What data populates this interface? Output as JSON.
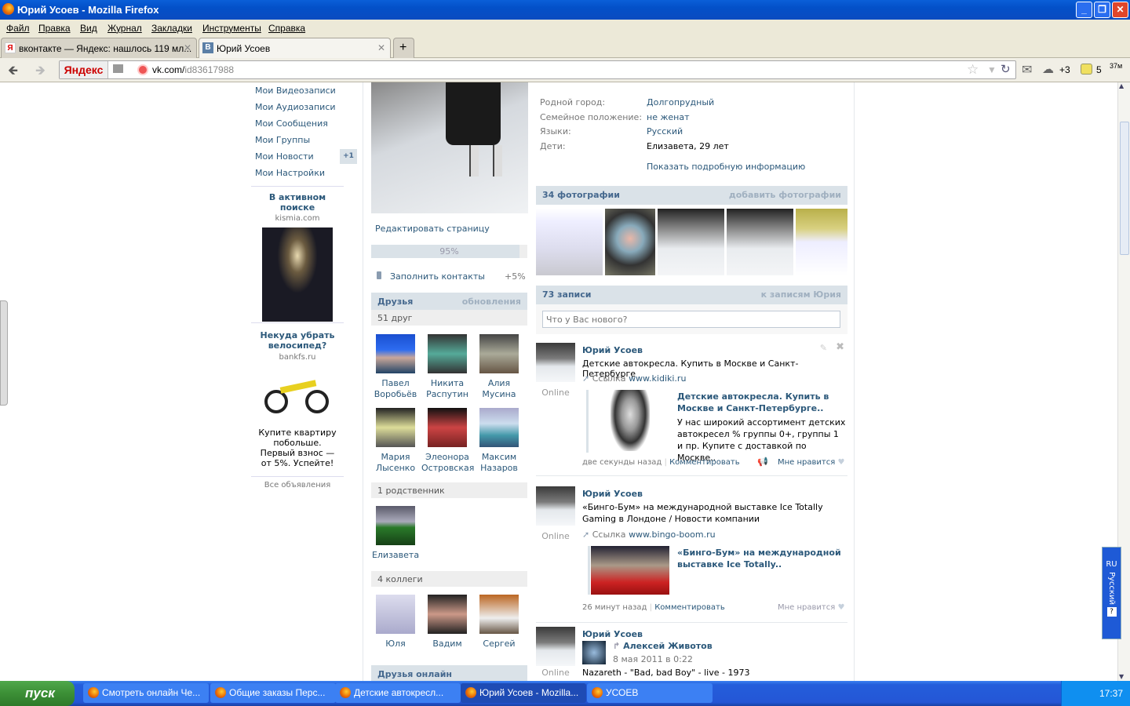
{
  "window": {
    "title": "Юрий Усоев - Mozilla Firefox"
  },
  "menu": [
    "Файл",
    "Правка",
    "Вид",
    "Журнал",
    "Закладки",
    "Инструменты",
    "Справка"
  ],
  "tabs": [
    {
      "label": "вконтакте — Яндекс: нашлось 119 мл...",
      "favicon": "Я"
    },
    {
      "label": "Юрий Усоев",
      "favicon": "В"
    }
  ],
  "nav": {
    "yandex": "Яндекс",
    "url_host": "vk.com/",
    "url_path": "id83617988",
    "cloud_count": "+3",
    "badge_count": "5",
    "mem": "37м"
  },
  "left_menu": [
    {
      "label": "Мои Видеозаписи"
    },
    {
      "label": "Мои Аудиозаписи"
    },
    {
      "label": "Мои Сообщения"
    },
    {
      "label": "Мои Группы"
    },
    {
      "label": "Мои Новости",
      "badge": "+1"
    },
    {
      "label": "Мои Настройки"
    }
  ],
  "ads": [
    {
      "title": "В активном поиске",
      "domain": "kismia.com"
    },
    {
      "title": "Некуда убрать велосипед?",
      "domain": "bankfs.ru",
      "text": "Купите квартиру побольше. Первый взнос — от 5%. Успейте!"
    }
  ],
  "all_ads": "Все объявления",
  "profile": {
    "edit": "Редактировать страницу",
    "progress_label": "95%",
    "progress": 95,
    "fill_contacts": "Заполнить контакты",
    "fill_bonus": "+5%"
  },
  "friends": {
    "title": "Друзья",
    "updates": "обновления",
    "count": "51 друг",
    "list": [
      [
        "Павел",
        "Воробьёв"
      ],
      [
        "Никита",
        "Распутин"
      ],
      [
        "Алия",
        "Мусина"
      ],
      [
        "Мария",
        "Лысенко"
      ],
      [
        "Элеонора",
        "Островская"
      ],
      [
        "Максим",
        "Назаров"
      ]
    ]
  },
  "relatives": {
    "count": "1 родственник",
    "list": [
      "Елизавета"
    ]
  },
  "colleagues": {
    "count": "4 коллеги",
    "list": [
      "Юля",
      "Вадим",
      "Сергей"
    ]
  },
  "friends_online": "Друзья онлайн",
  "info": [
    {
      "k": "Родной город:",
      "v": "Долгопрудный",
      "link": true
    },
    {
      "k": "Семейное положение:",
      "v": "не женат",
      "link": true
    },
    {
      "k": "Языки:",
      "v": "Русский",
      "link": true
    },
    {
      "k": "Дети:",
      "v": "Елизавета, 29 лет",
      "link": false
    }
  ],
  "show_more": "Показать подробную информацию",
  "photos": {
    "title": "34 фотографии",
    "add": "добавить фотографии"
  },
  "wall": {
    "title": "73 записи",
    "to_posts": "к записям Юрия",
    "placeholder": "Что у Вас нового?"
  },
  "posts": [
    {
      "author": "Юрий Усоев",
      "online": "Online",
      "text": "Детские автокресла. Купить в Москве и Санкт-Петербурге",
      "link_label": "Ссылка",
      "link": "www.kidiki.ru",
      "card_title": "Детские автокресла. Купить в Москве и Санкт-Петербурге..",
      "card_text": "У нас широкий ассортимент детских автокресел % группы 0+, группы 1 и пр. Купите с доставкой по Москве..",
      "time": "две секунды назад",
      "comment": "Комментировать",
      "like": "Мне нравится"
    },
    {
      "author": "Юрий Усоев",
      "online": "Online",
      "text": "«Бинго-Бум» на международной выставке Ice Totally Gaming в Лондоне / Новости компании",
      "link_label": "Ссылка",
      "link": "www.bingo-boom.ru",
      "card_title": "«Бинго-Бум» на международной выставке Ice Totally..",
      "time": "26 минут назад",
      "comment": "Комментировать",
      "like": "Мне нравится"
    },
    {
      "author": "Юрий Усоев",
      "online": "Online",
      "repost_author": "Алексей Животов",
      "repost_date": "8 мая 2011 в 0:22",
      "text": "Nazareth - \"Bad, bad Boy\" - live - 1973"
    }
  ],
  "lang": {
    "code": "RU",
    "name": "Русский"
  },
  "taskbar": {
    "start": "пуск",
    "items": [
      "Смотреть онлайн Че...",
      "Общие заказы Перс...",
      "Детские автокресл...",
      "Юрий Усоев - Mozilla...",
      "УСОЕВ"
    ],
    "clock": "17:37"
  }
}
